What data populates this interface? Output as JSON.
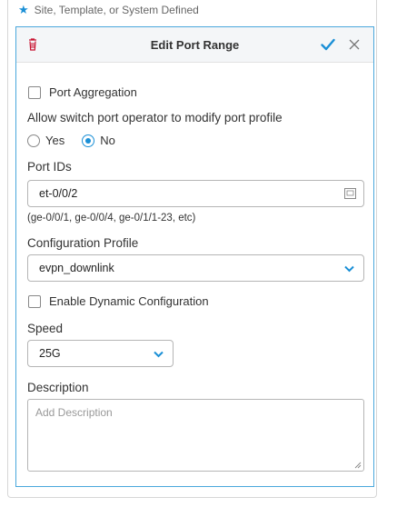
{
  "legend": {
    "star": "★",
    "text": "Site, Template, or System Defined"
  },
  "panel": {
    "title": "Edit Port Range",
    "port_aggregation": {
      "label": "Port Aggregation",
      "checked": false
    },
    "allow_modify": {
      "label": "Allow switch port operator to modify port profile",
      "options": [
        {
          "label": "Yes",
          "selected": false
        },
        {
          "label": "No",
          "selected": true
        }
      ]
    },
    "port_ids": {
      "label": "Port IDs",
      "value": "et-0/0/2",
      "hint": "(ge-0/0/1, ge-0/0/4, ge-0/1/1-23, etc)"
    },
    "config_profile": {
      "label": "Configuration Profile",
      "value": "evpn_downlink"
    },
    "dynamic_config": {
      "label": "Enable Dynamic Configuration",
      "checked": false
    },
    "speed": {
      "label": "Speed",
      "value": "25G"
    },
    "description": {
      "label": "Description",
      "placeholder": "Add Description"
    }
  },
  "colors": {
    "accent": "#1a8fd6",
    "panel_border": "#4aa8dc",
    "delete": "#c8102e"
  },
  "icons": [
    "star-icon",
    "trash-icon",
    "checkmark-icon",
    "close-icon",
    "lookup-icon",
    "chevron-down-icon",
    "resize-handle-icon"
  ]
}
